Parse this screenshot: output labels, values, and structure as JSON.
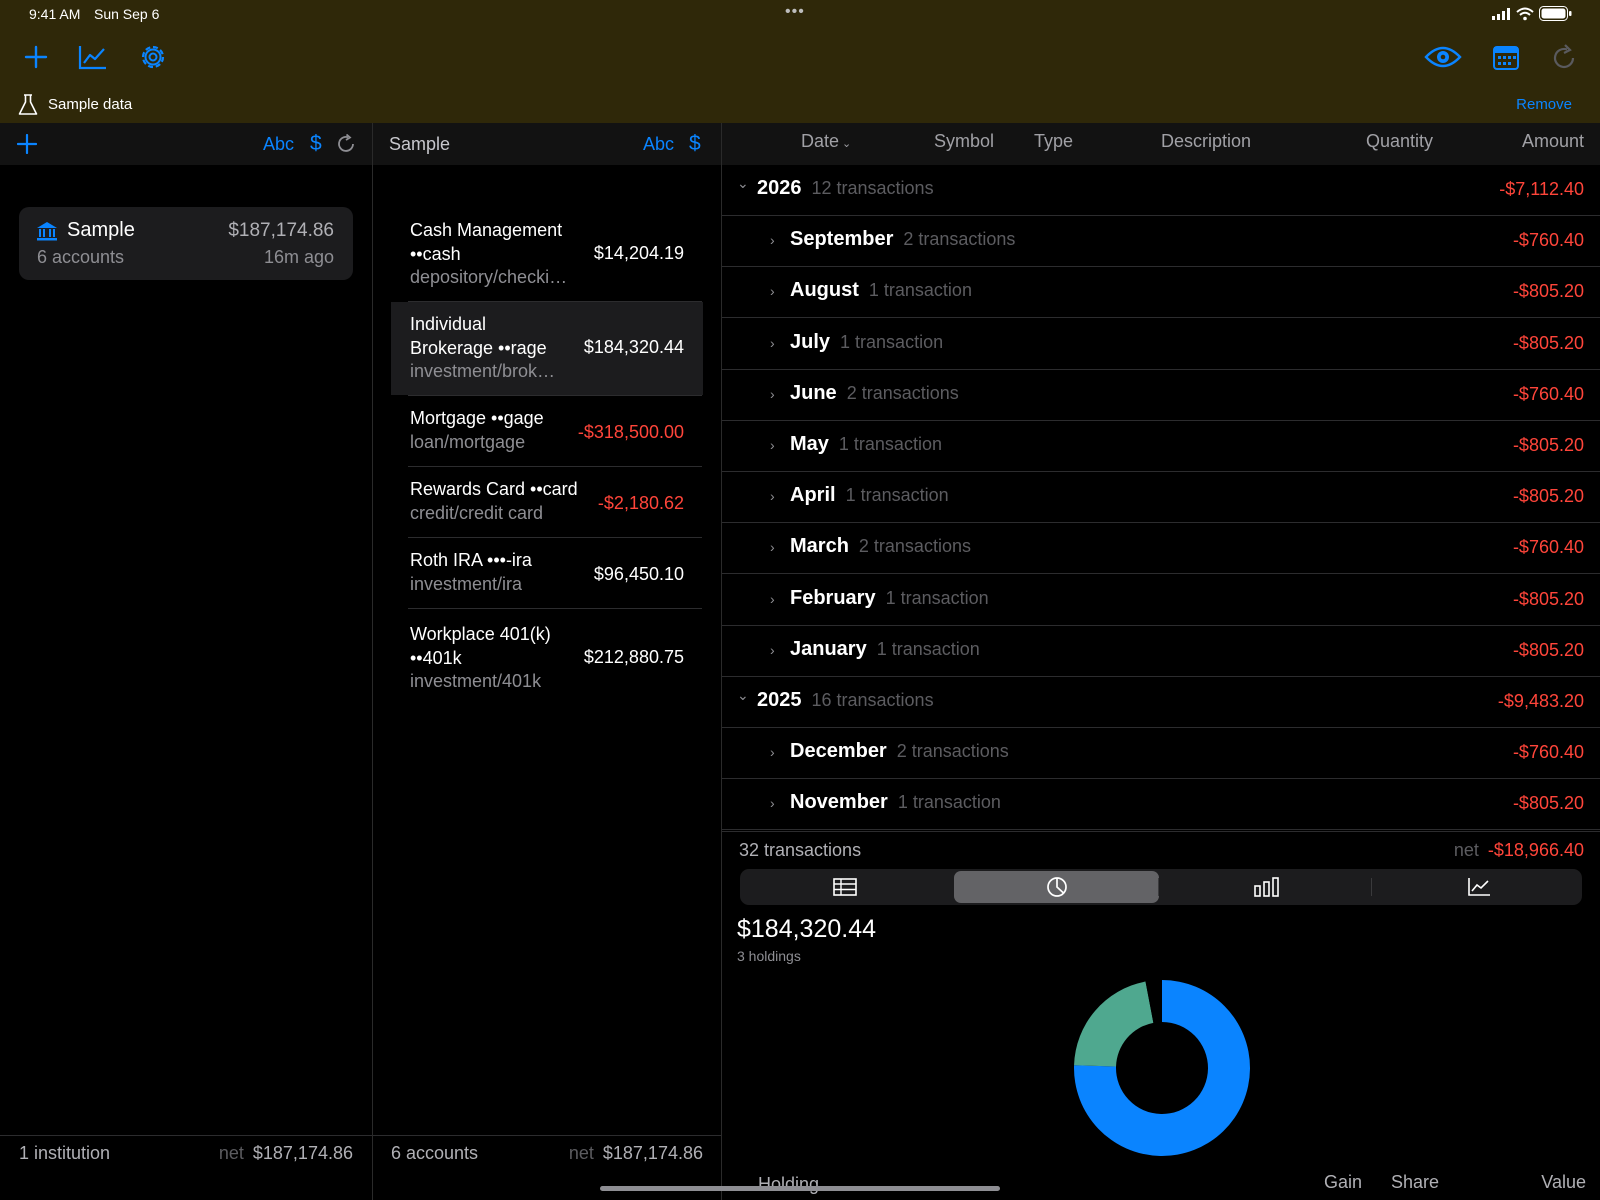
{
  "status": {
    "time": "9:41 AM",
    "date": "Sun Sep 6",
    "dots": "•••"
  },
  "toolbar": {
    "add_icon": "plus-icon",
    "chart_icon": "line-chart-icon",
    "settings_icon": "gear-icon",
    "eye_icon": "eye-icon",
    "calendar_icon": "calendar-icon",
    "refresh_icon": "refresh-icon"
  },
  "banner": {
    "label": "Sample data",
    "remove": "Remove"
  },
  "institutions": {
    "header": {
      "sort_name": "Abc",
      "sort_amount": "$"
    },
    "items": [
      {
        "name": "Sample",
        "sub": "6 accounts",
        "amount": "$187,174.86",
        "updated": "16m ago"
      }
    ],
    "footer": {
      "count": "1 institution",
      "net_label": "net",
      "net": "$187,174.86"
    }
  },
  "accounts": {
    "header": {
      "title": "Sample",
      "sort_name": "Abc",
      "sort_amount": "$"
    },
    "items": [
      {
        "line1": "Cash Management",
        "line2": "••cash",
        "line3": "depository/checki…",
        "amount": "$14,204.19"
      },
      {
        "line1": "Individual",
        "line2": "Brokerage ••rage",
        "line3": "investment/brok…",
        "amount": "$184,320.44"
      },
      {
        "line1": "Mortgage ••gage",
        "line2": "loan/mortgage",
        "amount": "-$318,500.00"
      },
      {
        "line1": "Rewards Card ••card",
        "line2": "credit/credit card",
        "amount": "-$2,180.62"
      },
      {
        "line1": "Roth IRA •••-ira",
        "line2": "investment/ira",
        "amount": "$96,450.10"
      },
      {
        "line1": "Workplace 401(k)",
        "line2": "••401k",
        "line3": "investment/401k",
        "amount": "$212,880.75"
      }
    ],
    "footer": {
      "count": "6 accounts",
      "net_label": "net",
      "net": "$187,174.86"
    }
  },
  "transactions": {
    "columns": {
      "date": "Date",
      "symbol": "Symbol",
      "type": "Type",
      "description": "Description",
      "quantity": "Quantity",
      "amount": "Amount"
    },
    "rows": [
      {
        "level": "year",
        "label": "2026",
        "count": "12 transactions",
        "amount": "-$7,112.40"
      },
      {
        "level": "month",
        "label": "September",
        "count": "2 transactions",
        "amount": "-$760.40"
      },
      {
        "level": "month",
        "label": "August",
        "count": "1 transaction",
        "amount": "-$805.20"
      },
      {
        "level": "month",
        "label": "July",
        "count": "1 transaction",
        "amount": "-$805.20"
      },
      {
        "level": "month",
        "label": "June",
        "count": "2 transactions",
        "amount": "-$760.40"
      },
      {
        "level": "month",
        "label": "May",
        "count": "1 transaction",
        "amount": "-$805.20"
      },
      {
        "level": "month",
        "label": "April",
        "count": "1 transaction",
        "amount": "-$805.20"
      },
      {
        "level": "month",
        "label": "March",
        "count": "2 transactions",
        "amount": "-$760.40"
      },
      {
        "level": "month",
        "label": "February",
        "count": "1 transaction",
        "amount": "-$805.20"
      },
      {
        "level": "month",
        "label": "January",
        "count": "1 transaction",
        "amount": "-$805.20"
      },
      {
        "level": "year",
        "label": "2025",
        "count": "16 transactions",
        "amount": "-$9,483.20"
      },
      {
        "level": "month",
        "label": "December",
        "count": "2 transactions",
        "amount": "-$760.40"
      },
      {
        "level": "month",
        "label": "November",
        "count": "1 transaction",
        "amount": "-$805.20"
      }
    ],
    "footer": {
      "count": "32 transactions",
      "net_label": "net",
      "net": "-$18,966.40"
    }
  },
  "holdings": {
    "segments": [
      "table-icon",
      "pie-chart-icon",
      "bar-chart-icon",
      "line-chart-icon"
    ],
    "selected_segment": 1,
    "total": "$184,320.44",
    "sub": "3 holdings",
    "columns": {
      "holding": "Holding",
      "gain": "Gain",
      "share": "Share",
      "value": "Value"
    }
  },
  "chart_data": {
    "type": "pie",
    "title": "",
    "values": [
      0.755,
      0.215,
      0.03
    ],
    "colors": [
      "#0a84ff",
      "#4fa88f",
      "#000000"
    ]
  }
}
